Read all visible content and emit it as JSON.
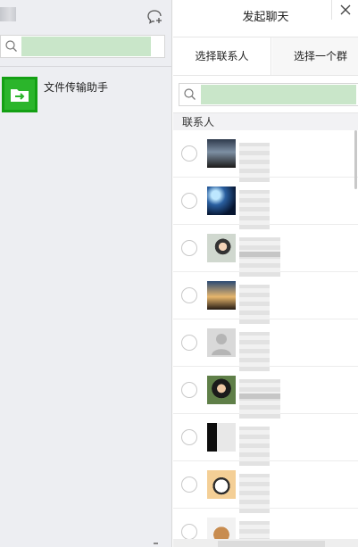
{
  "left_panel": {
    "search": {
      "value": "",
      "placeholder": ""
    },
    "conversations": [
      {
        "title": "文件传输助手",
        "icon": "file-transfer-icon",
        "icon_color": "#2bb52b"
      }
    ]
  },
  "dialog": {
    "title": "发起聊天",
    "close_icon": "close-icon",
    "tabs": [
      {
        "label": "选择联系人",
        "active": true
      },
      {
        "label": "选择一个群",
        "active": false
      }
    ],
    "search": {
      "value": "",
      "placeholder": ""
    },
    "section_header": "联系人",
    "contacts": [
      {
        "avatar": "night-sky-photo"
      },
      {
        "avatar": "earth-space-photo"
      },
      {
        "avatar": "girl-portrait-photo"
      },
      {
        "avatar": "sunset-silhouette-photo"
      },
      {
        "avatar": "default-person-avatar"
      },
      {
        "avatar": "girl-portrait-photo"
      },
      {
        "avatar": "person-photo"
      },
      {
        "avatar": "cartoon-panda-avatar"
      },
      {
        "avatar": "dog-photo"
      }
    ]
  },
  "colors": {
    "accent_green": "#2bb52b",
    "search_highlight": "#c9e6c9",
    "sidebar_bg": "#edeef2"
  }
}
